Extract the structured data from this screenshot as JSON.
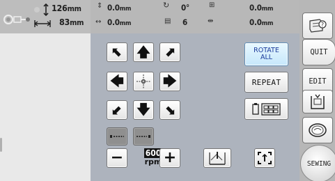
{
  "preview": {
    "height_value": "126",
    "height_unit": "mm",
    "width_value": "83",
    "width_unit": "mm"
  },
  "info": {
    "offset_y": "0.0",
    "offset_x": "0.0",
    "rotation": "0°",
    "colors": "6",
    "area_y": "0.0",
    "area_x": "0.0",
    "unit": "mm"
  },
  "buttons": {
    "rotate_all_line1": "ROTATE",
    "rotate_all_line2": "ALL",
    "repeat": "REPEAT",
    "quit": "QUIT",
    "edit": "EDIT",
    "sewing": "SEWING"
  },
  "arrows": {
    "up_left": "⬉",
    "up": "🡅",
    "up_right": "⬈",
    "left": "🡄",
    "right": "🡆",
    "down_left": "⬋",
    "down": "🡇",
    "down_right": "⬊"
  },
  "speed": {
    "minus": "−",
    "value": "600",
    "unit": "rpm",
    "plus": "+"
  },
  "colors": {
    "rotate_bg": "#c6e7fb",
    "rotate_text": "#1a3a9a",
    "panel_bg": "#adb3bd"
  },
  "icons": [
    "help-icon",
    "frame-icon",
    "center-icon",
    "embroidery-frame-icon",
    "thread-icon",
    "needle-icon",
    "trial-icon",
    "hoop-icon",
    "multi-frame-icon"
  ]
}
